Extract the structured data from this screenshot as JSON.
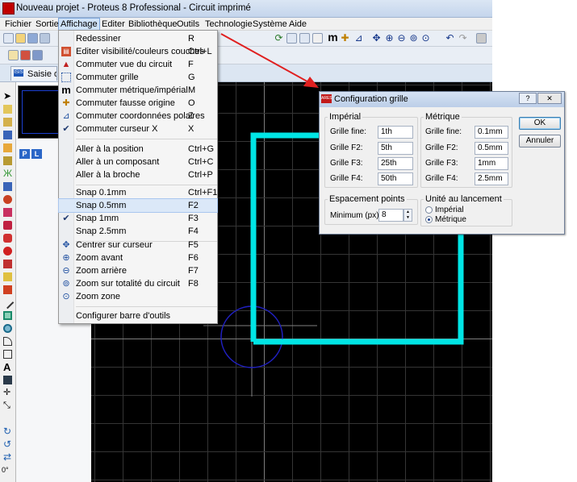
{
  "window": {
    "title": "Nouveau projet - Proteus 8 Professional - Circuit imprimé"
  },
  "menubar": [
    "Fichier",
    "Sortie",
    "Affichage",
    "Editer",
    "Bibliothèque",
    "Outils",
    "Technologie",
    "Système",
    "Aide"
  ],
  "tab": {
    "label": "Saisie de s",
    "icon_text": "ISIS"
  },
  "sidepanel": {
    "p_button": "P",
    "l_button": "L",
    "rotation": "0°"
  },
  "affichage_menu": {
    "items": [
      {
        "label": "Redessiner",
        "shortcut": "R",
        "icon": "none"
      },
      {
        "label": "Editer visibilité/couleurs couches",
        "shortcut": "Ctrl+L",
        "icon": "layers-icon"
      },
      {
        "label": "Commuter vue du circuit",
        "shortcut": "F",
        "icon": "flip-view-icon"
      },
      {
        "label": "Commuter grille",
        "shortcut": "G",
        "icon": "grid-icon"
      },
      {
        "label": "Commuter métrique/impérial",
        "shortcut": "M",
        "icon": "metric-icon",
        "icon_glyph": "m"
      },
      {
        "label": "Commuter fausse origine",
        "shortcut": "O",
        "icon": "origin-icon"
      },
      {
        "label": "Commuter coordonnées polaires",
        "shortcut": "Z",
        "icon": "polar-icon"
      },
      {
        "label": "Commuter curseur X",
        "shortcut": "X",
        "icon": "check-icon",
        "checked": true
      },
      {
        "label": "Aller à la position",
        "shortcut": "Ctrl+G",
        "icon": "none"
      },
      {
        "label": "Aller à un composant",
        "shortcut": "Ctrl+C",
        "icon": "none"
      },
      {
        "label": "Aller à la broche",
        "shortcut": "Ctrl+P",
        "icon": "none"
      },
      {
        "label": "Snap 0.1mm",
        "shortcut": "Ctrl+F1",
        "icon": "none"
      },
      {
        "label": "Snap 0.5mm",
        "shortcut": "F2",
        "icon": "none",
        "highlighted": true
      },
      {
        "label": "Snap 1mm",
        "shortcut": "F3",
        "icon": "check-icon",
        "checked": true
      },
      {
        "label": "Snap 2.5mm",
        "shortcut": "F4",
        "icon": "none"
      },
      {
        "label": "Centrer sur curseur",
        "shortcut": "F5",
        "icon": "center-icon"
      },
      {
        "label": "Zoom avant",
        "shortcut": "F6",
        "icon": "zoom-in-icon"
      },
      {
        "label": "Zoom arrière",
        "shortcut": "F7",
        "icon": "zoom-out-icon"
      },
      {
        "label": "Zoom sur totalité du circuit",
        "shortcut": "F8",
        "icon": "zoom-all-icon"
      },
      {
        "label": "Zoom zone",
        "shortcut": "",
        "icon": "zoom-area-icon"
      },
      {
        "label": "Configurer barre d'outils",
        "shortcut": "",
        "icon": "none"
      }
    ]
  },
  "dialog": {
    "title": "Configuration grille",
    "icon_text": "ARES",
    "imperial": {
      "legend": "Impérial",
      "rows": [
        {
          "label": "Grille fine:",
          "value": "1th"
        },
        {
          "label": "Grille F2:",
          "value": "5th"
        },
        {
          "label": "Grille F3:",
          "value": "25th"
        },
        {
          "label": "Grille F4:",
          "value": "50th"
        }
      ]
    },
    "metrique": {
      "legend": "Métrique",
      "rows": [
        {
          "label": "Grille fine:",
          "value": "0.1mm"
        },
        {
          "label": "Grille F2:",
          "value": "0.5mm"
        },
        {
          "label": "Grille F3:",
          "value": "1mm"
        },
        {
          "label": "Grille F4:",
          "value": "2.5mm"
        }
      ]
    },
    "espacement": {
      "legend": "Espacement points",
      "label": "Minimum (px):",
      "value": "8"
    },
    "unite": {
      "legend": "Unité au lancement",
      "options": [
        "Impérial",
        "Métrique"
      ],
      "selected": "Métrique"
    },
    "ok_label": "OK",
    "cancel_label": "Annuler"
  },
  "colors": {
    "trace": "#00e5e5",
    "arrow": "#e02020",
    "canvas_bg": "#000000",
    "menu_highlight": "#dbe8f8"
  }
}
